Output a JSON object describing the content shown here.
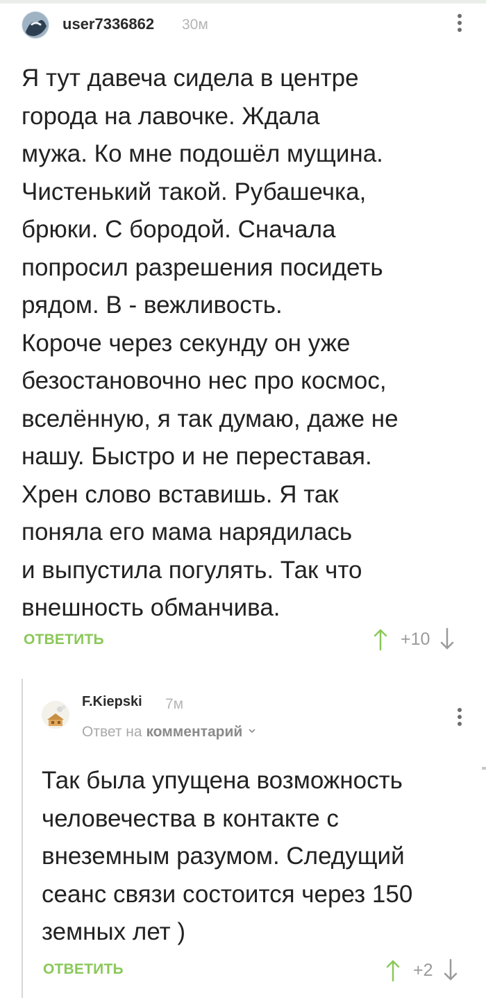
{
  "comments": [
    {
      "username": "user7336862",
      "time": "30м",
      "text": "Я тут давеча сидела в центре\nгорода на лавочке. Ждала\nмужа. Ко мне подошёл мущина.\nЧистенький такой. Рубашечка,\nбрюки. С бородой. Сначала\nпопросил разрешения посидеть\nрядом. В - вежливость.\nКороче через секунду он уже\nбезостановочно нес про космос,\nвселённую, я так думаю, даже не\nнашу. Быстро и не переставая.\nХрен слово вставишь. Я так\nпоняла его мама нарядилась\nи выпустила погулять. Так что\nвнешность обманчива.",
      "reply_label": "ОТВЕТИТЬ",
      "rating": "+10"
    },
    {
      "username": "F.Kiepski",
      "time": "7м",
      "reply_prefix": "Ответ на",
      "reply_target": "комментарий",
      "text": "Так была упущена возможность\nчеловечества в контакте с\nвнеземным разумом. Следущий\nсеанс связи состоится через 150\nземных лет )",
      "reply_label": "ОТВЕТИТЬ",
      "rating": "+2"
    }
  ],
  "colors": {
    "accent_green": "#8ac858",
    "meta_gray": "#b4b4b4",
    "arrow_up": "#8ac858",
    "arrow_down": "#9a9a9a"
  },
  "icons": [
    "avatar",
    "more-vertical-icon",
    "arrow-up-icon",
    "arrow-down-icon",
    "chevron-down-icon"
  ]
}
